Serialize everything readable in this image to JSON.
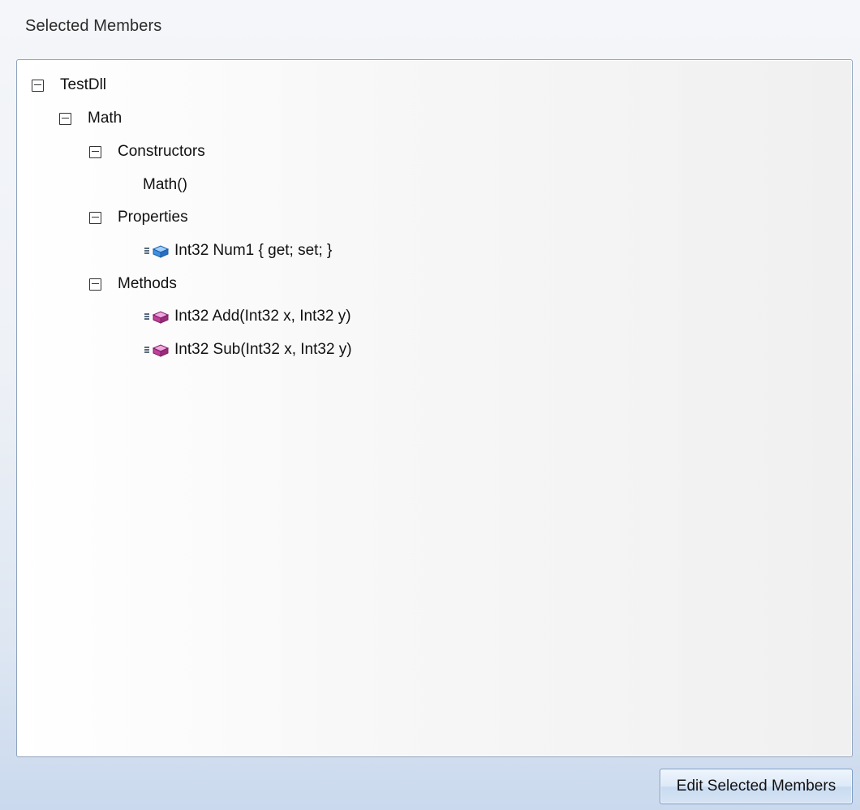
{
  "panel": {
    "title": "Selected Members"
  },
  "tree": {
    "root": {
      "label": "TestDll"
    },
    "class": {
      "label": "Math"
    },
    "constructors": {
      "label": "Constructors",
      "items": [
        "Math()"
      ]
    },
    "properties": {
      "label": "Properties",
      "items": [
        "Int32 Num1 { get; set; }"
      ],
      "icon": "property-icon",
      "icon_color": "#3f8fe0"
    },
    "methods": {
      "label": "Methods",
      "items": [
        "Int32 Add(Int32 x, Int32 y)",
        "Int32 Sub(Int32 x, Int32 y)"
      ],
      "icon": "method-icon",
      "icon_color": "#c0409a"
    }
  },
  "footer": {
    "edit_button_label": "Edit Selected Members"
  }
}
